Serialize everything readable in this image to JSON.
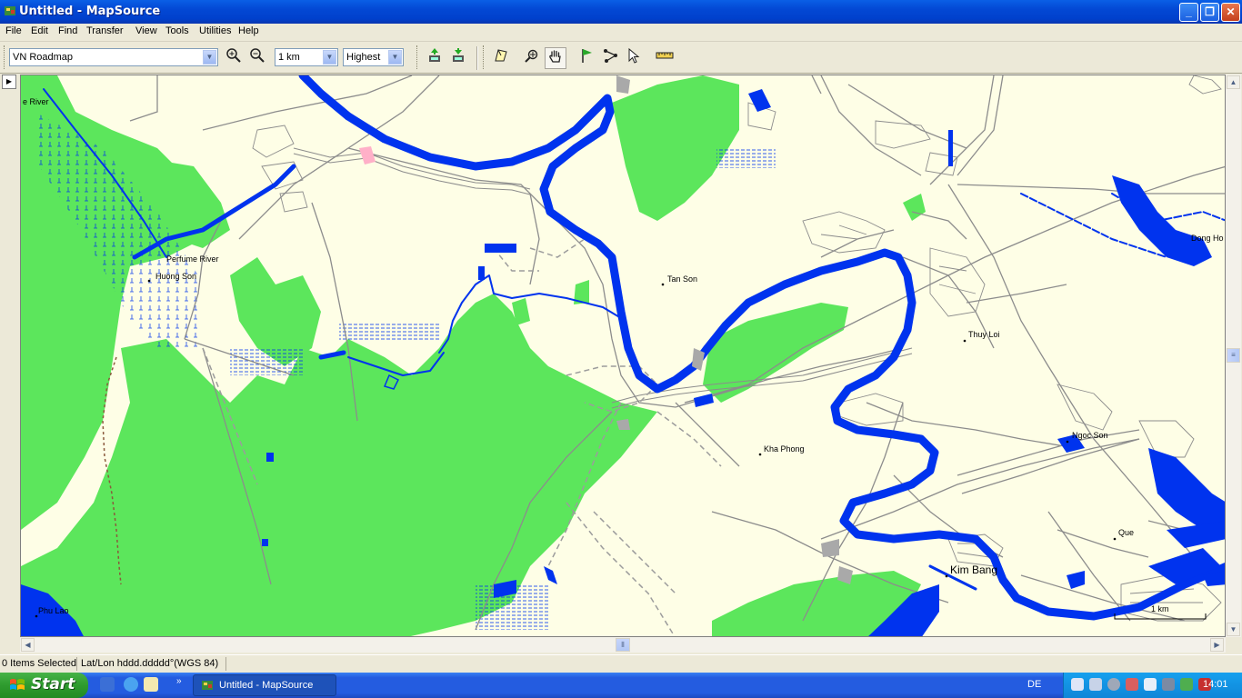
{
  "window": {
    "title": "Untitled - MapSource"
  },
  "menu": [
    "File",
    "Edit",
    "Find",
    "Transfer",
    "View",
    "Tools",
    "Utilities",
    "Help"
  ],
  "toolbar": {
    "map_product": "VN Roadmap",
    "zoom_scale": "1 km",
    "detail": "Highest"
  },
  "map": {
    "labels": {
      "river_top_left": "e River",
      "perfume_river": "Perfume River",
      "huong_son": "Huong Son",
      "tan_son": "Tan Son",
      "thuy_loi": "Thuy Loi",
      "kha_phong": "Kha Phong",
      "ngoc_son": "Ngoc Son",
      "que": "Que",
      "kim_bang": "Kim Bang",
      "phu_lao": "Phu Lao",
      "dong_hoa": "Dong Ho"
    },
    "scale_bar": "1 km",
    "colors": {
      "background": "#fefee6",
      "forest": "#5ce65c",
      "water": "#0033ee",
      "road": "#a0a0a0"
    }
  },
  "statusbar": {
    "selection": "0 Items Selected",
    "position_format": "Lat/Lon hddd.ddddd°(WGS 84)"
  },
  "taskbar": {
    "start": "Start",
    "task": "Untitled - MapSource",
    "language": "DE",
    "clock": "14:01"
  }
}
